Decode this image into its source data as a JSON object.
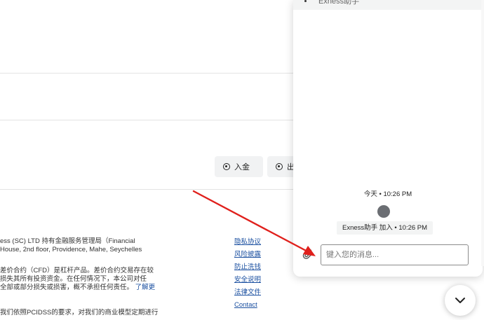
{
  "page": {
    "buttons": {
      "deposit_label": "入金",
      "withdraw_label": "出"
    },
    "footer": {
      "lines": [
        "ess (SC) LTD 持有金融服务管理局（Financial",
        "House, 2nd floor, Providence, Mahe, Seychelles",
        "差价合约（CFD）是杠杆产品。差价合约交易存在较",
        "损失其所有投资资金。在任何情况下，本公司对任",
        "全部或部分损失或损害，概不承担任何责任。",
        "我们依照PCIDSS的要求，对我们的商业模型定期进行"
      ],
      "learn_more": "了解更",
      "links": [
        "隐私协议",
        "风险披露",
        "防止洗钱",
        "安全说明",
        "法律文件",
        "Contact"
      ]
    }
  },
  "chat": {
    "header_title": "Exness助手",
    "time_label": "今天 • 10:26 PM",
    "join_label": "Exness助手 加入 • 10:26 PM",
    "input_placeholder": "键入您的消息...",
    "icons": {
      "attach": "paperclip-icon",
      "avatar": "agent-avatar",
      "fab": "chevron-down-icon"
    }
  },
  "colors": {
    "link": "#1a4fa0",
    "arrow": "#e0201c",
    "avatar": "#6b6e73"
  }
}
